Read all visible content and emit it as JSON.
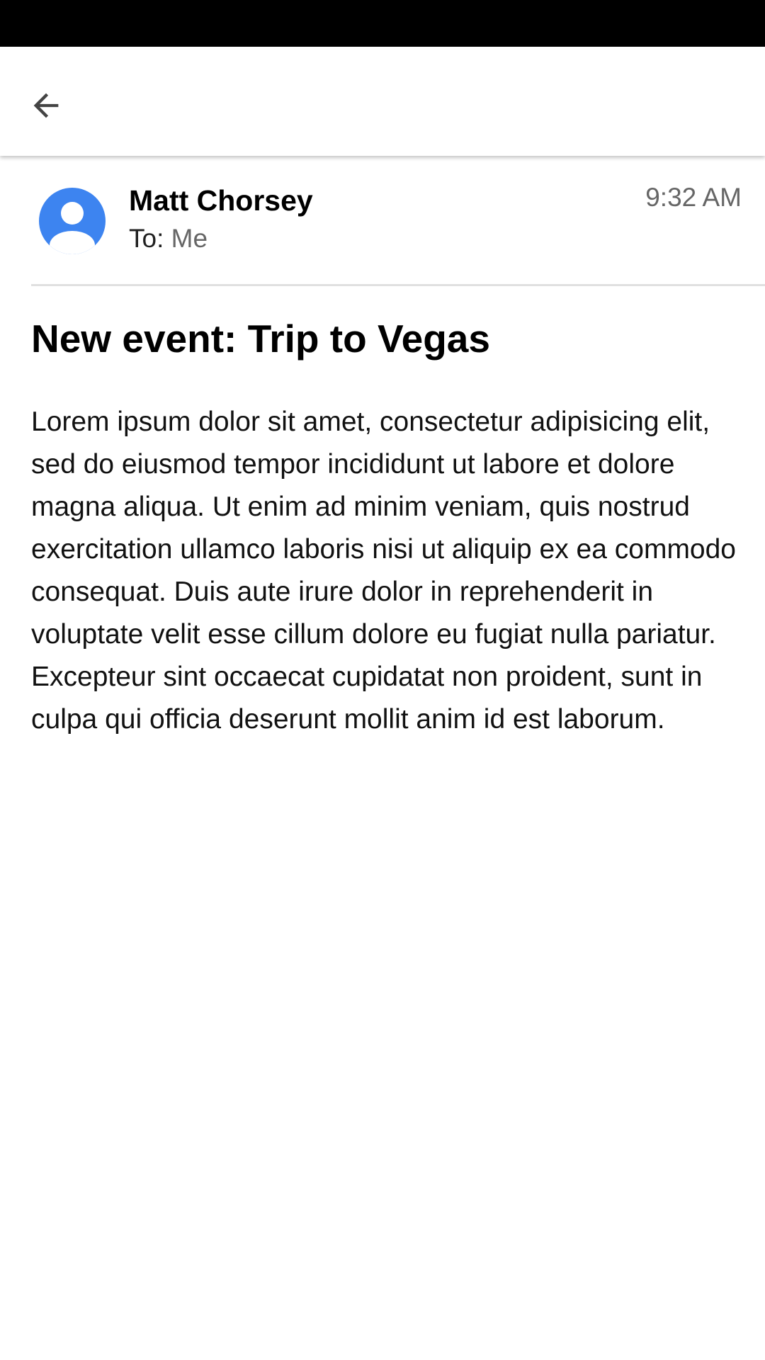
{
  "email": {
    "sender_name": "Matt Chorsey",
    "to_label": "To:",
    "recipient": "Me",
    "time": "9:32 AM",
    "subject": "New event: Trip to Vegas",
    "body": "Lorem ipsum dolor sit amet, consectetur adipisicing elit, sed do eiusmod tempor incididunt ut labore et dolore magna aliqua. Ut enim ad minim veniam, quis nostrud exercitation ullamco laboris nisi ut aliquip ex ea commodo consequat. Duis aute irure dolor in reprehenderit in voluptate velit esse cillum dolore eu fugiat nulla pariatur. Excepteur sint occaecat cupidatat non proident, sunt in culpa qui officia deserunt mollit anim id est laborum."
  },
  "icons": {
    "back": "arrow-back-icon",
    "avatar": "account-circle-icon"
  },
  "colors": {
    "avatar": "#3d84f0",
    "status_bar": "#000000",
    "divider": "#e0e0e0",
    "secondary_text": "#666666"
  }
}
